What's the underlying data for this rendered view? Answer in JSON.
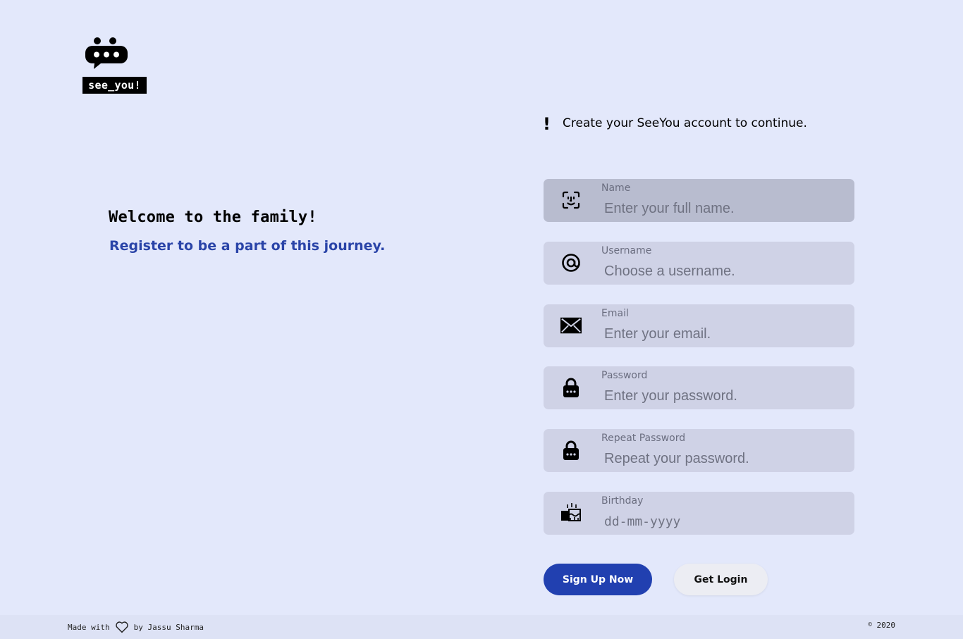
{
  "brand": {
    "logo_text": "see_you!",
    "logo_icon": "chat-bubble-dots-icon"
  },
  "hero": {
    "title": "Welcome to the family!",
    "subtitle": "Register to be a part of this journey."
  },
  "notice": {
    "mark": "!",
    "text": "Create your SeeYou account to continue."
  },
  "form": {
    "fields": [
      {
        "label": "Name",
        "placeholder": "Enter your full name.",
        "icon": "face-scan-icon"
      },
      {
        "label": "Username",
        "placeholder": "Choose a username.",
        "icon": "at-sign-icon"
      },
      {
        "label": "Email",
        "placeholder": "Enter your email.",
        "icon": "envelope-icon"
      },
      {
        "label": "Password",
        "placeholder": "Enter your password.",
        "icon": "lock-icon"
      },
      {
        "label": "Repeat Password",
        "placeholder": "Repeat your password.",
        "icon": "lock-icon"
      },
      {
        "label": "Birthday",
        "placeholder": "dd-mm-yyyy",
        "icon": "birthday-cake-icon"
      }
    ],
    "signup_label": "Sign Up Now",
    "login_label": "Get Login"
  },
  "footer": {
    "made_with": "Made with",
    "by_author": "by Jassu Sharma",
    "copyright_symbol": "©",
    "year": "2020"
  },
  "colors": {
    "background": "#e3e8fb",
    "accent": "#2140b0",
    "subtitle": "#2a44a8",
    "field_bg": "#cfd2e6",
    "field_bg_active": "#b8bccf"
  }
}
